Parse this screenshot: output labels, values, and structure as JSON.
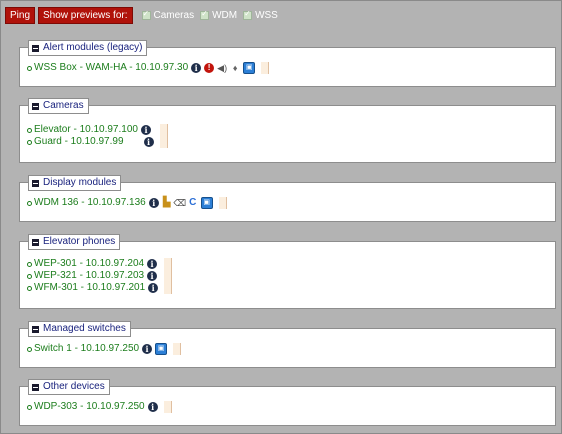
{
  "toolbar": {
    "ping_label": "Ping",
    "show_previews_label": "Show previews for:",
    "filters": [
      "Cameras",
      "WDM",
      "WSS"
    ]
  },
  "sections": [
    {
      "title": "Alert modules (legacy)",
      "devices": [
        {
          "label": "WSS Box - WAM-HA - 10.10.97.30",
          "icons": [
            "info-icon",
            "alert-icon",
            "speaker-icon",
            "microphone-icon",
            "preview-icon"
          ]
        }
      ]
    },
    {
      "title": "Cameras",
      "devices": [
        {
          "label": "Elevator - 10.10.97.100",
          "icons": [
            "info-icon"
          ]
        },
        {
          "label": "Guard - 10.10.97.99",
          "icons": [
            "info-icon"
          ]
        }
      ]
    },
    {
      "title": "Display modules",
      "devices": [
        {
          "label": "WDM 136 - 10.10.97.136",
          "icons": [
            "info-icon",
            "folder-icon",
            "backspace-icon",
            "refresh-icon",
            "preview-icon"
          ]
        }
      ]
    },
    {
      "title": "Elevator phones",
      "devices": [
        {
          "label": "WEP-301 - 10.10.97.204",
          "icons": [
            "info-icon"
          ]
        },
        {
          "label": "WEP-321 - 10.10.97.203",
          "icons": [
            "info-icon"
          ]
        },
        {
          "label": "WFM-301 - 10.10.97.201",
          "icons": [
            "info-icon"
          ]
        }
      ]
    },
    {
      "title": "Managed switches",
      "devices": [
        {
          "label": "Switch 1 - 10.10.97.250",
          "icons": [
            "info-icon",
            "preview-icon"
          ]
        }
      ]
    },
    {
      "title": "Other devices",
      "devices": [
        {
          "label": "WDP-303 - 10.10.97.250",
          "icons": [
            "info-icon"
          ]
        }
      ]
    }
  ]
}
